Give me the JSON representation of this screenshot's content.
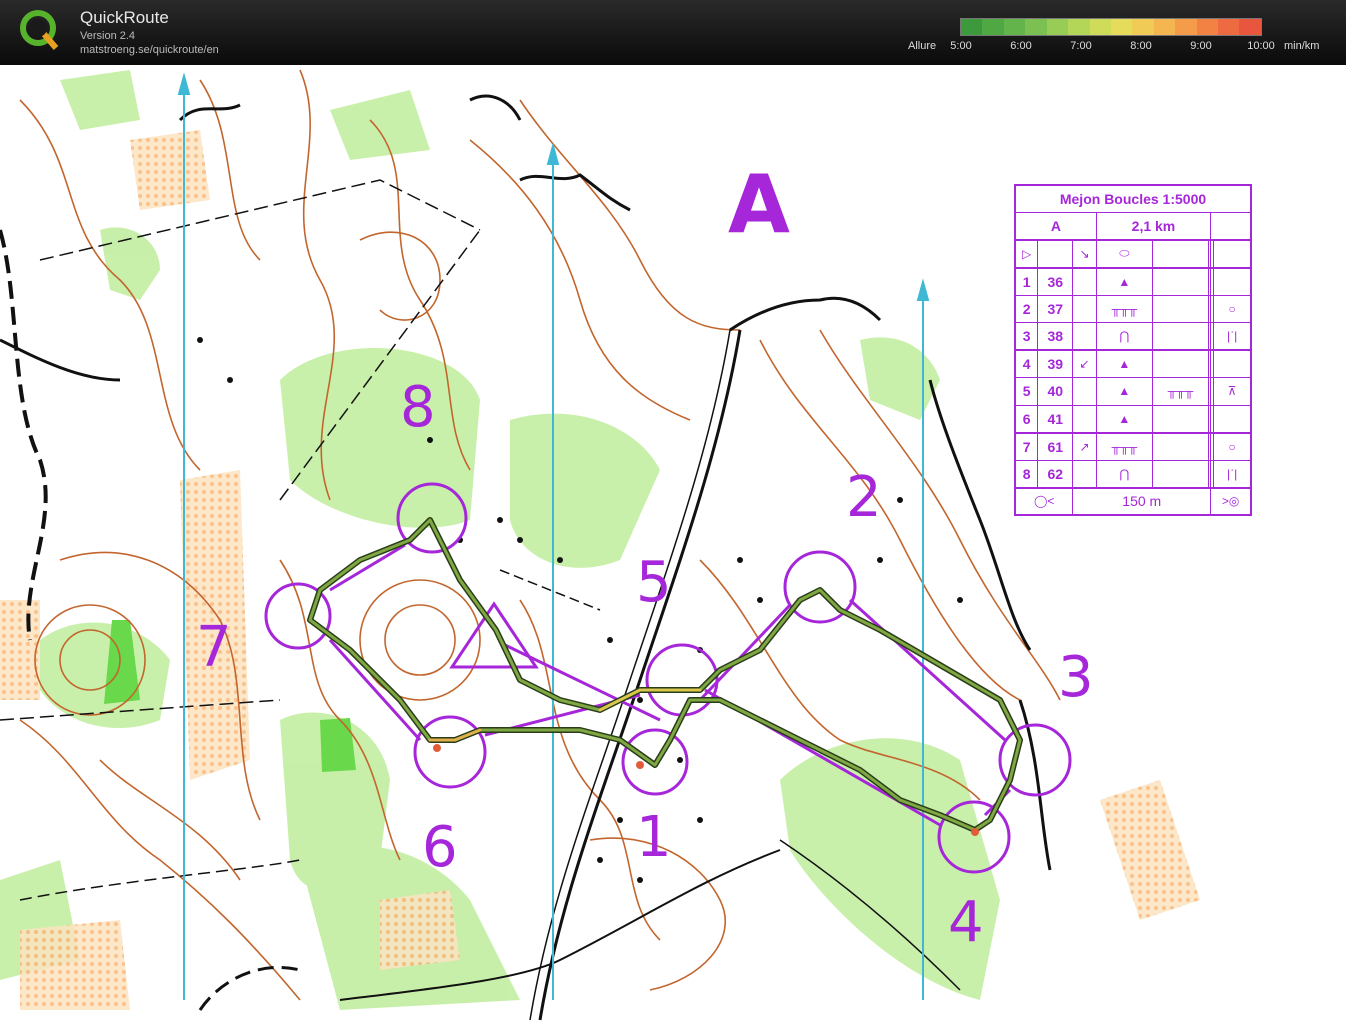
{
  "app": {
    "title": "QuickRoute",
    "version": "Version 2.4",
    "url": "matstroeng.se/quickroute/en"
  },
  "pace_scale": {
    "label": "Allure",
    "ticks": [
      "5:00",
      "6:00",
      "7:00",
      "8:00",
      "9:00",
      "10:00"
    ],
    "unit": "min/km",
    "colors": [
      "#3c9a3c",
      "#4fa844",
      "#64b44c",
      "#7cc052",
      "#98cc56",
      "#b4d658",
      "#cedc5a",
      "#e4dc5a",
      "#f0cc56",
      "#f4b650",
      "#f49c4a",
      "#f28244",
      "#ee6a40",
      "#e8563e"
    ]
  },
  "map": {
    "course_letter": "A",
    "colors": {
      "course": "#a626d9",
      "contour": "#c2662e",
      "vegetation": "#9ee07a",
      "open_land": "#f9cf94",
      "north_lines": "#3fb8d6",
      "route": "#5f8a3a"
    },
    "control_numbers": [
      {
        "label": "1"
      },
      {
        "label": "2"
      },
      {
        "label": "3"
      },
      {
        "label": "4"
      },
      {
        "label": "5"
      },
      {
        "label": "6"
      },
      {
        "label": "7"
      },
      {
        "label": "8"
      }
    ]
  },
  "description": {
    "title": "Mejon Boucles 1:5000",
    "course": "A",
    "length": "2,1 km",
    "controls": [
      {
        "num": "1",
        "code": "36",
        "dir": "",
        "feature": "▲",
        "detail": "",
        "extra": ""
      },
      {
        "num": "2",
        "code": "37",
        "dir": "",
        "feature": "╥╥╥",
        "detail": "",
        "extra": "○"
      },
      {
        "num": "3",
        "code": "38",
        "dir": "",
        "feature": "⋂",
        "detail": "",
        "extra": "|ˈ|"
      },
      {
        "num": "4",
        "code": "39",
        "dir": "↙",
        "feature": "▲",
        "detail": "",
        "extra": ""
      },
      {
        "num": "5",
        "code": "40",
        "dir": "",
        "feature": "▲",
        "detail": "╥╥╥",
        "extra": "⊼"
      },
      {
        "num": "6",
        "code": "41",
        "dir": "",
        "feature": "▲",
        "detail": "",
        "extra": ""
      },
      {
        "num": "7",
        "code": "61",
        "dir": "↗",
        "feature": "╥╥╥",
        "detail": "",
        "extra": "○"
      },
      {
        "num": "8",
        "code": "62",
        "dir": "",
        "feature": "⋂",
        "detail": "",
        "extra": "|ˈ|"
      }
    ],
    "finish_distance": "150 m"
  }
}
